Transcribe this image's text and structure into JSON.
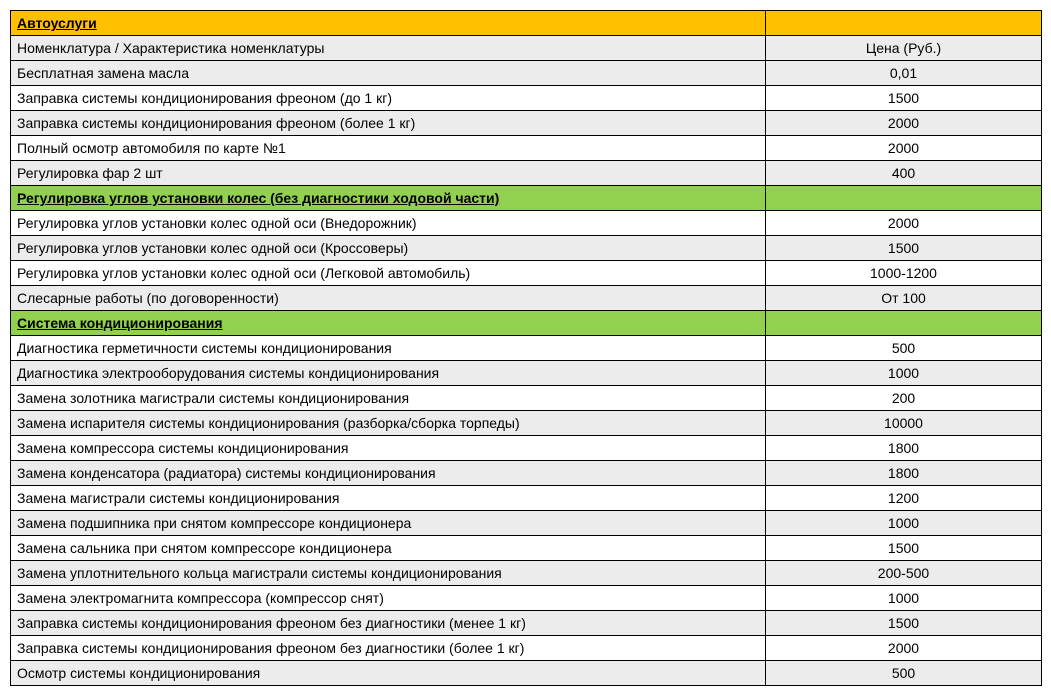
{
  "section_auto": {
    "title": "Автоуслуги",
    "header": {
      "name": "Номенклатура / Характеристика номенклатуры",
      "price": "Цена (Руб.)"
    },
    "rows": [
      {
        "name": "Бесплатная замена масла",
        "price": "0,01"
      },
      {
        "name": "Заправка системы кондиционирования фреоном (до 1 кг)",
        "price": "1500"
      },
      {
        "name": "Заправка системы кондиционирования фреоном (более 1 кг)",
        "price": "2000"
      },
      {
        "name": "Полный осмотр автомобиля по карте №1",
        "price": "2000"
      },
      {
        "name": "Регулировка фар 2 шт",
        "price": "400"
      }
    ]
  },
  "section_wheel": {
    "title": "Регулировка углов установки колес (без диагностики ходовой части)",
    "rows": [
      {
        "name": "Регулировка углов установки колес одной оси  (Внедорожник)",
        "price": "2000"
      },
      {
        "name": "Регулировка углов установки колес одной оси  (Кроссоверы)",
        "price": "1500"
      },
      {
        "name": "Регулировка углов установки колес одной оси (Легковой автомобиль)",
        "price": "1000-1200"
      },
      {
        "name": "Слесарные работы (по договоренности)",
        "price": "От 100"
      }
    ]
  },
  "section_ac": {
    "title": "Система кондиционирования",
    "rows": [
      {
        "name": "Диагностика герметичности системы кондиционирования",
        "price": "500"
      },
      {
        "name": "Диагностика электрооборудования системы кондиционирования",
        "price": "1000"
      },
      {
        "name": "Замена золотника магистрали системы кондиционирования",
        "price": "200"
      },
      {
        "name": "Замена испарителя системы кондиционирования (разборка/сборка торпеды)",
        "price": "10000"
      },
      {
        "name": "Замена компрессора системы кондиционирования",
        "price": "1800"
      },
      {
        "name": "Замена конденсатора (радиатора) системы кондиционирования",
        "price": "1800"
      },
      {
        "name": "Замена магистрали системы кондиционирования",
        "price": "1200"
      },
      {
        "name": "Замена подшипника при снятом компрессоре кондиционера",
        "price": "1000"
      },
      {
        "name": "Замена сальника при снятом компрессоре кондиционера",
        "price": "1500"
      },
      {
        "name": "Замена уплотнительного кольца магистрали системы кондиционирования",
        "price": "200-500"
      },
      {
        "name": "Замена электромагнита компрессора (компрессор снят)",
        "price": "1000"
      },
      {
        "name": "Заправка системы кондиционирования фреоном без  диагностики (менее 1 кг)",
        "price": "1500"
      },
      {
        "name": "Заправка системы кондиционирования фреоном без  диагностики (более 1 кг)",
        "price": "2000"
      },
      {
        "name": "Осмотр системы кондиционирования",
        "price": "500"
      }
    ]
  }
}
